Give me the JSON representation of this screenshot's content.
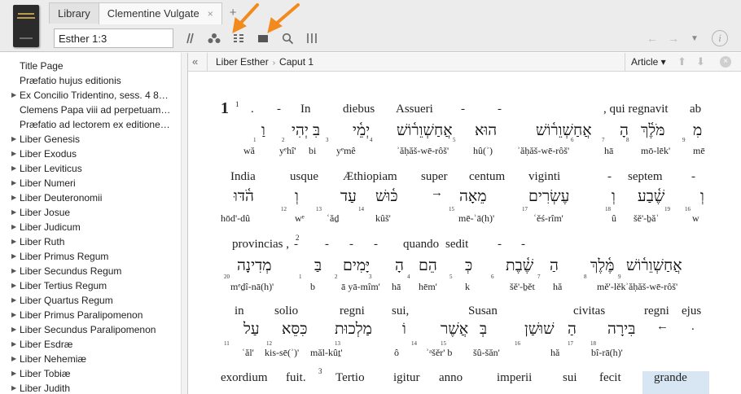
{
  "tabs": [
    {
      "label": "Library",
      "active": false
    },
    {
      "label": "Clementine Vulgate",
      "active": true,
      "close": "×"
    }
  ],
  "tab_add": "+",
  "reference_input": {
    "value": "Esther 1:3"
  },
  "toolbar_icons": [
    "parallel-icon",
    "cluster-icon",
    "list-icon",
    "panel-icon",
    "search-icon",
    "columns-icon"
  ],
  "nav": {
    "back": "←",
    "forward": "→",
    "menu": "▼",
    "info": "i"
  },
  "sidebar": {
    "items": [
      {
        "label": "Title Page",
        "expandable": false
      },
      {
        "label": "Præfatio hujus editionis",
        "expandable": false
      },
      {
        "label": "Ex Concilio Tridentino, sess. 4 8…",
        "expandable": true
      },
      {
        "label": "Clemens Papa viii ad perpetuam…",
        "expandable": false
      },
      {
        "label": "Præfatio ad lectorem ex editione…",
        "expandable": false
      },
      {
        "label": "Liber Genesis",
        "expandable": true
      },
      {
        "label": "Liber Exodus",
        "expandable": true
      },
      {
        "label": "Liber Leviticus",
        "expandable": true
      },
      {
        "label": "Liber Numeri",
        "expandable": true
      },
      {
        "label": "Liber Deuteronomii",
        "expandable": true
      },
      {
        "label": "Liber Josue",
        "expandable": true
      },
      {
        "label": "Liber Judicum",
        "expandable": true
      },
      {
        "label": "Liber Ruth",
        "expandable": true
      },
      {
        "label": "Liber Primus Regum",
        "expandable": true
      },
      {
        "label": "Liber Secundus Regum",
        "expandable": true
      },
      {
        "label": "Liber Tertius Regum",
        "expandable": true
      },
      {
        "label": "Liber Quartus Regum",
        "expandable": true
      },
      {
        "label": "Liber Primus Paralipomenon",
        "expandable": true
      },
      {
        "label": "Liber Secundus Paralipomenon",
        "expandable": true
      },
      {
        "label": "Liber Esdræ",
        "expandable": true
      },
      {
        "label": "Liber Nehemiæ",
        "expandable": true
      },
      {
        "label": "Liber Tobiæ",
        "expandable": true
      },
      {
        "label": "Liber Judith",
        "expandable": true
      }
    ]
  },
  "breadcrumb": {
    "collapse": "«",
    "book": "Liber Esther",
    "separator": "›",
    "chapter": "Caput 1",
    "view_menu": "Article ▾",
    "up": "⬆",
    "down": "⬇",
    "close": "×"
  },
  "text": {
    "chapter": "1",
    "verse1": "1",
    "verse2": "2",
    "verse3": "3",
    "rows": [
      {
        "latin": [
          ".",
          "-",
          "In",
          "diebus",
          "Assueri",
          "-",
          "-",
          ", qui regnavit",
          "ab"
        ],
        "hebrew": [
          "מִ",
          "מֹּלֶ֫ךְ",
          "הָ",
          "אֲחַשְׁוֵר֫וֹשׁ",
          "הוּא",
          "אֲחַשְׁוֵר֫וֹשׁ",
          "יְמֵ֫י",
          "בִּ",
          "יְהִי",
          "וַ"
        ],
        "translit": [
          "mē",
          "mō-lēk'",
          "hā",
          "ʾăḥăš-wē-rôš'",
          "hû(ʾ)",
          "ʾăḥăš-wē-rôš'",
          "yᵉmê",
          "bi",
          "yᵉhî'",
          "wă"
        ],
        "nums": [
          "9",
          "8",
          "7",
          "6",
          "5",
          "4",
          "3",
          "2",
          "1"
        ]
      },
      {
        "latin": [
          "India",
          "usque",
          "Æthiopiam",
          "super",
          "centum",
          "viginti",
          "-",
          "septem",
          "-"
        ],
        "hebrew": [
          "הֹ֫דּוּ",
          "וְ",
          "עַד",
          "כּ֫וּשׁ",
          "מֵאָה",
          "עֶשְׂרִים",
          "וְ",
          "שֶׁ֫בַע",
          "וְ"
        ],
        "translit": [
          "hōd'-dû",
          "wᵉ",
          "ʿăḏ",
          "kûš'",
          "mē-ʾā(h)'",
          "ʿěś-rîm'",
          "û",
          "šě'-ḇăʿ",
          "w"
        ],
        "nums": [
          "12",
          "13",
          "14",
          "15",
          "17",
          "18",
          "19",
          "16"
        ]
      },
      {
        "latin": [
          "provincias ,",
          "-",
          "-",
          "-",
          "-",
          "quando",
          "sedit",
          "-",
          "-"
        ],
        "hebrew": [
          "מְדִינָה",
          "בַּ",
          "יָּמִים",
          "הָ",
          "הֵם",
          "כְּ",
          "שֶׁ֫בֶת",
          "הַ",
          "מֶּ֫לֶךְ",
          "אֲחַשְׁוֵר֫וֹשׁ"
        ],
        "translit": [
          "mᵉḏî-nā(h)'",
          "b",
          "ā yā-mîm'",
          "hā",
          "hēm'",
          "k",
          "šě'-ḇět",
          "hă",
          "mě'-lěk",
          "ʾăḥăš-wē-rôš'"
        ],
        "nums": [
          "20",
          "1",
          "2",
          "3",
          "4",
          "5",
          "6",
          "7",
          "8",
          "9"
        ]
      },
      {
        "latin": [
          "in",
          "solio",
          "regni",
          "sui,",
          "Susan",
          "civitas",
          "regni",
          "ejus"
        ],
        "hebrew": [
          "עַל",
          "כִּסֵּא",
          "מַלְכוּת",
          "וֹ",
          "אֲשֶׁר",
          "בְּ",
          "שׁוּשַׁן",
          "הַ",
          "בִּירָה"
        ],
        "translit": [
          "ʿăl'",
          "kis-sē(ʾ)'",
          "măl-kûṯ'",
          "ô",
          "ʾᵃšěr' b",
          "šû-šăn'",
          "hă",
          "bî-rā(h)'"
        ],
        "nums": [
          "11",
          "12",
          "13",
          "14",
          "15",
          "16",
          "17",
          "18"
        ]
      },
      {
        "latin": [
          "exordium",
          "fuit.",
          "Tertio",
          "igitur",
          "anno",
          "imperii",
          "sui",
          "fecit",
          "grande"
        ]
      }
    ]
  }
}
